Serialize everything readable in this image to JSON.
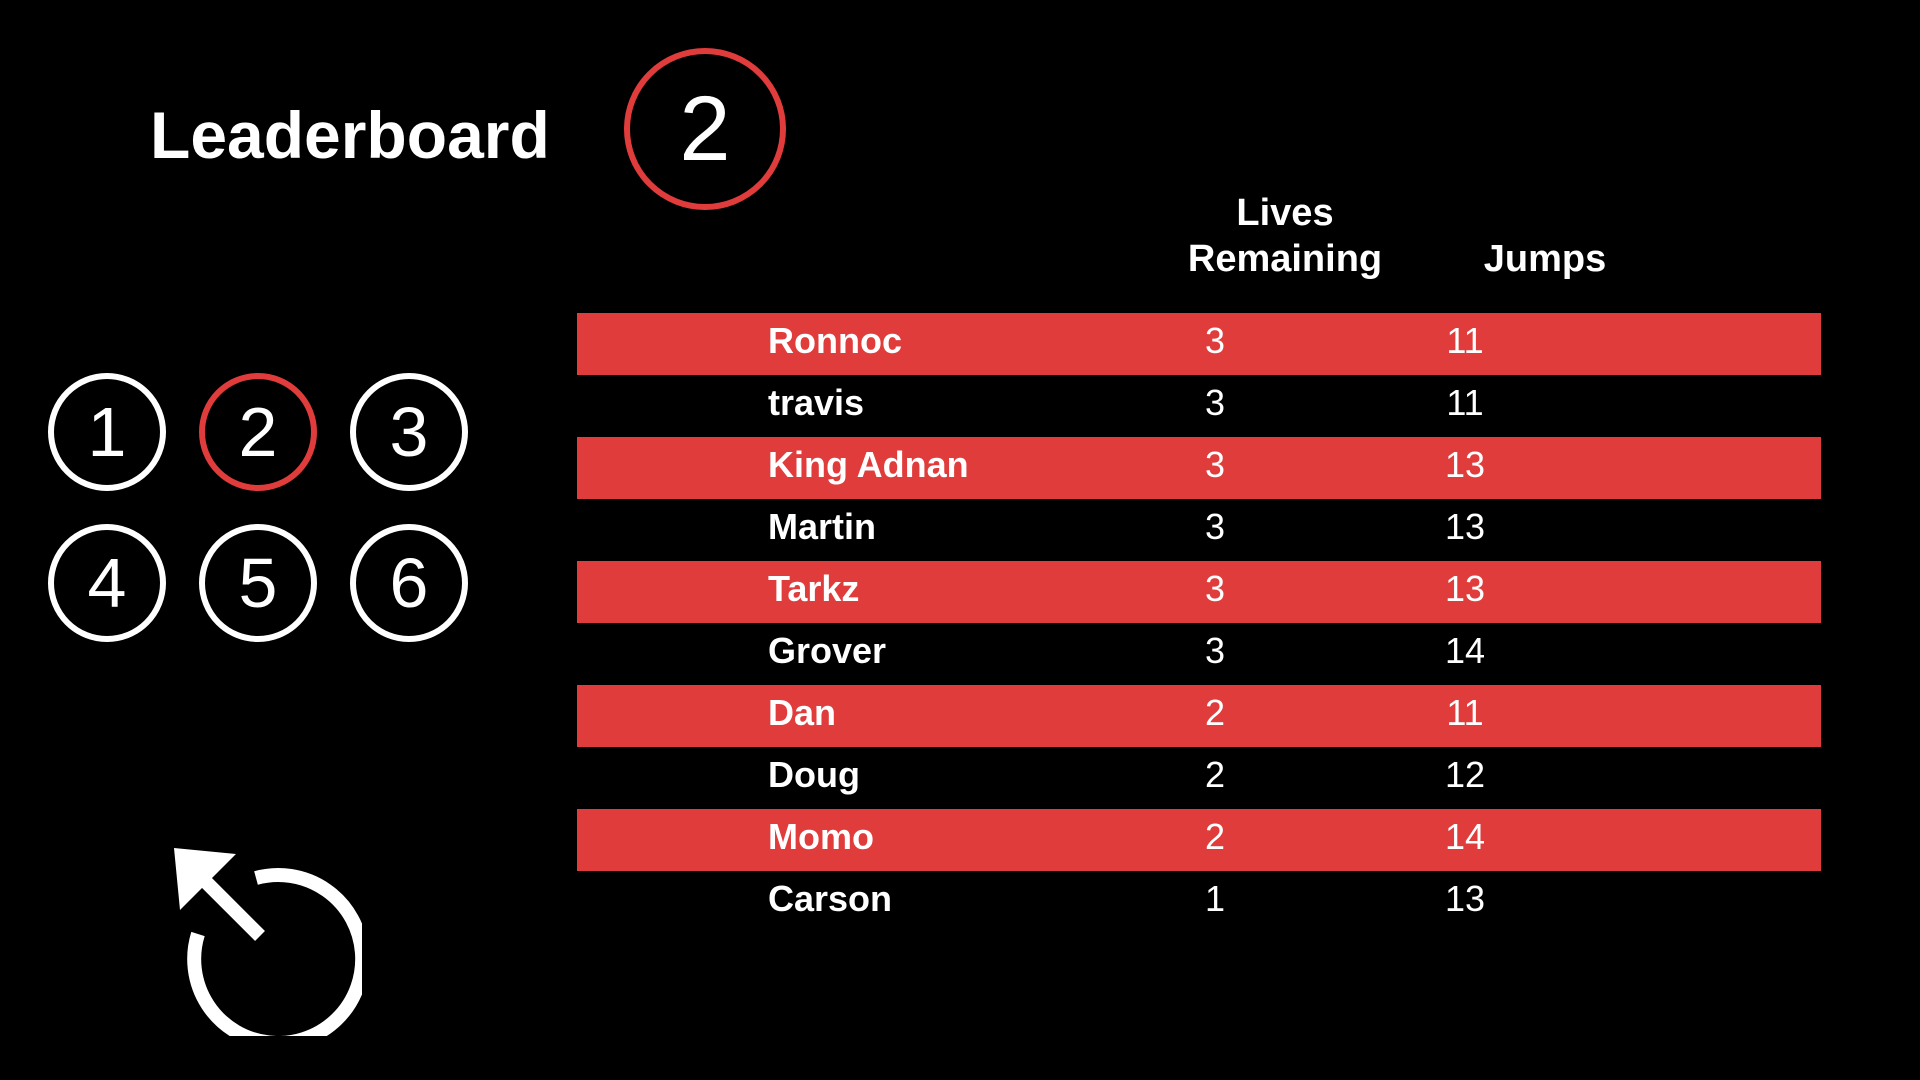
{
  "header": {
    "title": "Leaderboard",
    "current_level": "2"
  },
  "levels": [
    {
      "label": "1",
      "active": false
    },
    {
      "label": "2",
      "active": true
    },
    {
      "label": "3",
      "active": false
    },
    {
      "label": "4",
      "active": false
    },
    {
      "label": "5",
      "active": false
    },
    {
      "label": "6",
      "active": false
    }
  ],
  "columns": {
    "lives_line1": "Lives",
    "lives_line2": "Remaining",
    "jumps": "Jumps"
  },
  "rows": [
    {
      "name": "Ronnoc",
      "lives": "3",
      "jumps": "11"
    },
    {
      "name": "travis",
      "lives": "3",
      "jumps": "11"
    },
    {
      "name": "King Adnan",
      "lives": "3",
      "jumps": "13"
    },
    {
      "name": "Martin",
      "lives": "3",
      "jumps": "13"
    },
    {
      "name": "Tarkz",
      "lives": "3",
      "jumps": "13"
    },
    {
      "name": "Grover",
      "lives": "3",
      "jumps": "14"
    },
    {
      "name": "Dan",
      "lives": "2",
      "jumps": "11"
    },
    {
      "name": "Doug",
      "lives": "2",
      "jumps": "12"
    },
    {
      "name": "Momo",
      "lives": "2",
      "jumps": "14"
    },
    {
      "name": "Carson",
      "lives": "1",
      "jumps": "13"
    }
  ],
  "colors": {
    "accent": "#e03c3c",
    "background": "#000000",
    "text": "#ffffff"
  },
  "icons": {
    "reset": "restart-icon"
  }
}
